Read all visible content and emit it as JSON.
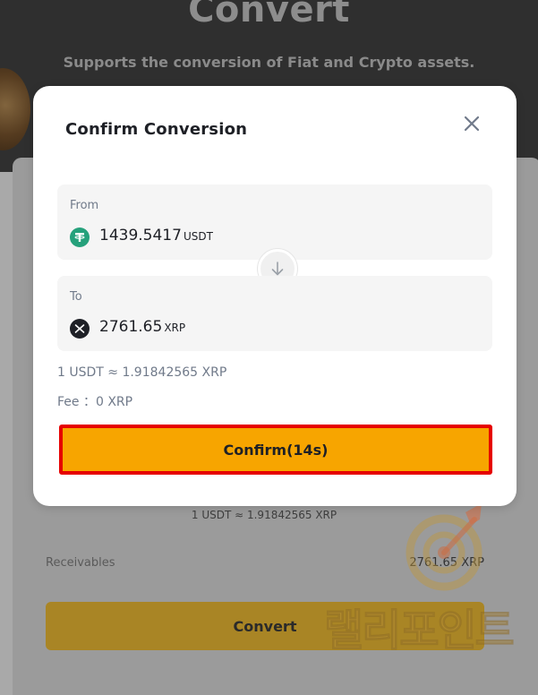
{
  "background": {
    "title": "Convert",
    "subtitle": "Supports the conversion of Fiat and Crypto assets.",
    "rate": "1 USDT ≈ 1.91842565 XRP",
    "receivables_label": "Receivables",
    "receivables_value": "2761.65 XRP",
    "convert_button": "Convert"
  },
  "watermark": {
    "text": "랠리포인트"
  },
  "modal": {
    "title": "Confirm Conversion",
    "from": {
      "label": "From",
      "amount": "1439.5417",
      "unit": "USDT",
      "icon": "tether-icon"
    },
    "to": {
      "label": "To",
      "amount": "2761.65",
      "unit": "XRP",
      "icon": "xrp-icon"
    },
    "rate": "1 USDT ≈ 1.91842565 XRP",
    "fee": "Fee ：0 XRP",
    "confirm_button": "Confirm(14s)"
  },
  "colors": {
    "accent": "#f7a500",
    "highlight_border": "#e60000",
    "tether": "#26a17b",
    "xrp": "#1e2026"
  }
}
